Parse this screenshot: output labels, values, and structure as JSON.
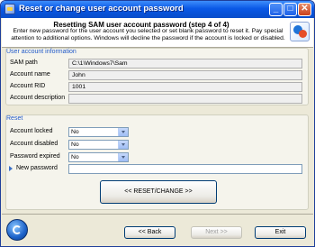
{
  "window": {
    "title": "Reset or change user account password",
    "buttons": {
      "minimize": "_",
      "maximize": "□",
      "close": "✕"
    }
  },
  "header": {
    "title": "Resetting SAM user account password (step 4 of 4)",
    "description": "Enter new password for the user account you selected or set blank password to reset it. Pay special attention to additional options. Windows will decline the password if the account is locked or disabled."
  },
  "user_info": {
    "group_label": "User account information",
    "sam_path_label": "SAM path",
    "sam_path_value": "C:\\1\\Windows7\\Sam",
    "account_name_label": "Account name",
    "account_name_value": "John",
    "account_rid_label": "Account RID",
    "account_rid_value": "1001",
    "account_description_label": "Account description",
    "account_description_value": ""
  },
  "reset": {
    "group_label": "Reset",
    "account_locked_label": "Account locked",
    "account_locked_value": "No",
    "account_disabled_label": "Account disabled",
    "account_disabled_value": "No",
    "password_expired_label": "Password expired",
    "password_expired_value": "No",
    "new_password_label": "New password",
    "new_password_value": "",
    "reset_button": "<< RESET/CHANGE >>"
  },
  "footer": {
    "back_button": "<< Back",
    "next_button": "Next >>",
    "exit_button": "Exit"
  },
  "icons": {
    "app": "key-icon",
    "header": "wizard-logo-icon",
    "footer": "app-logo-icon",
    "dropdown": "chevron-down-icon",
    "pointer": "arrow-right-icon"
  },
  "colors": {
    "titlebar": "#0a58e6",
    "group_label": "#2059c8",
    "window_bg": "#ece9d8"
  }
}
